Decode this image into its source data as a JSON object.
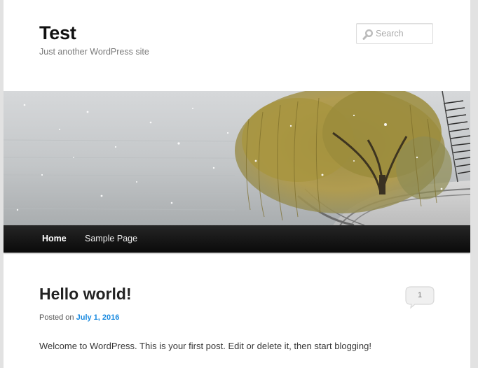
{
  "site": {
    "title": "Test",
    "description": "Just another WordPress site"
  },
  "search": {
    "placeholder": "Search",
    "icon": "search-icon"
  },
  "header_image": {
    "icon": "snowy-willow-lake-image"
  },
  "nav": {
    "items": [
      {
        "label": "Home",
        "current": true
      },
      {
        "label": "Sample Page",
        "current": false
      }
    ]
  },
  "post": {
    "title": "Hello world!",
    "meta_prefix": "Posted on",
    "date": "July 1, 2016",
    "comment_count": "1",
    "content": "Welcome to WordPress. This is your first post. Edit or delete it, then start blogging!"
  },
  "colors": {
    "link": "#1b8be0",
    "nav_background": "#111111"
  }
}
